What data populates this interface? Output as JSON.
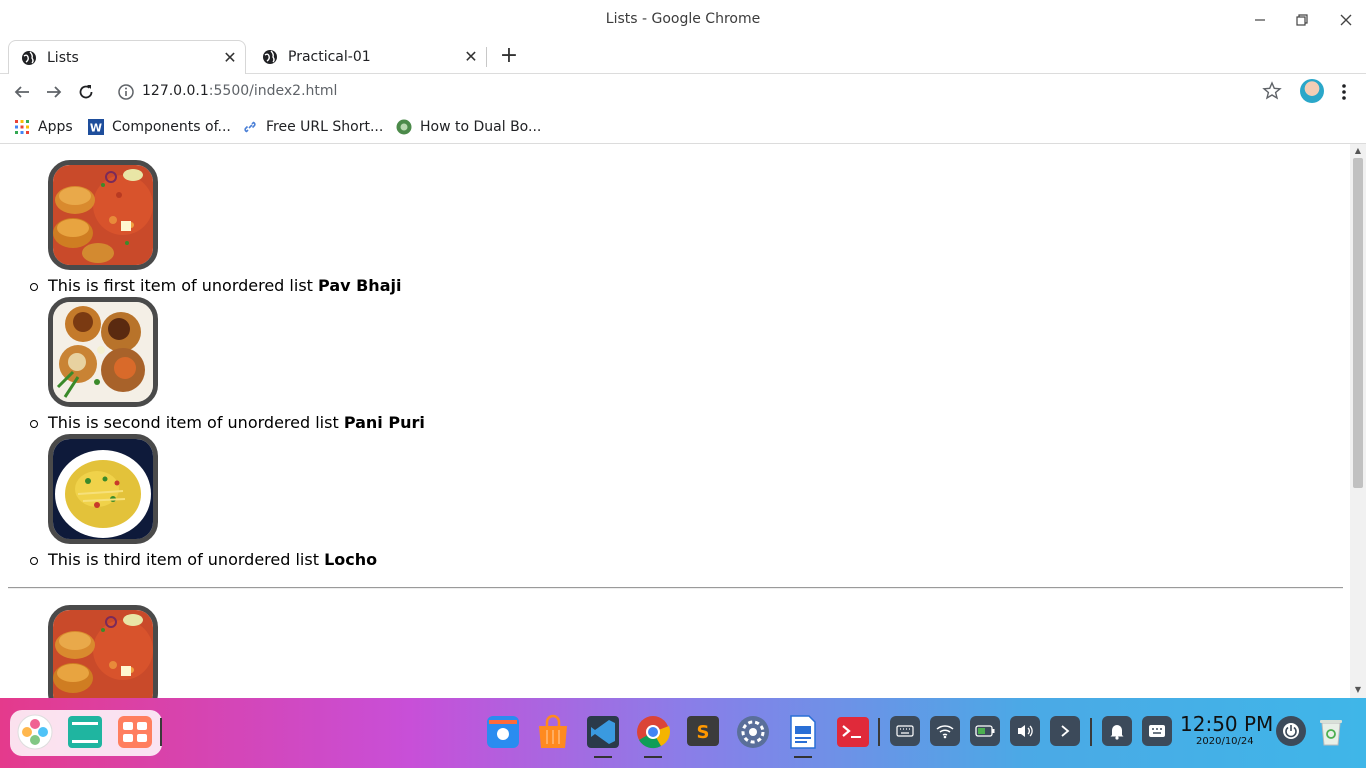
{
  "window": {
    "title": "Lists - Google Chrome"
  },
  "tabs": [
    {
      "label": "Lists",
      "active": true,
      "icon": "globe-icon"
    },
    {
      "label": "Practical-01",
      "active": false,
      "icon": "globe-icon"
    }
  ],
  "address_bar": {
    "url_host": "127.0.0.1",
    "url_rest": ":5500/index2.html"
  },
  "bookmarks": [
    {
      "label": "Apps",
      "icon": "apps-grid-icon"
    },
    {
      "label": "Components of...",
      "icon": "word-doc-icon"
    },
    {
      "label": "Free URL Short...",
      "icon": "link-icon"
    },
    {
      "label": "How to Dual Bo...",
      "icon": "site-icon"
    }
  ],
  "page": {
    "items": [
      {
        "text": "This is first item of unordered list ",
        "bold": "Pav Bhaji",
        "image": "pav-bhaji"
      },
      {
        "text": "This is second item of unordered list ",
        "bold": "Pani Puri",
        "image": "pani-puri"
      },
      {
        "text": "This is third item of unordered list ",
        "bold": "Locho",
        "image": "locho"
      }
    ],
    "second_list_first_image": "pav-bhaji"
  },
  "taskbar": {
    "time": "12:50 PM",
    "date": "2020/10/24",
    "apps": [
      "launcher-icon",
      "terminal-files-icon",
      "multitask-icon",
      "finder-icon",
      "app-store-icon",
      "vscode-icon",
      "chrome-icon",
      "sublime-text-icon",
      "settings-icon",
      "writer-icon",
      "terminal-icon"
    ],
    "tray": [
      "keyboard-icon",
      "wifi-icon",
      "battery-icon",
      "volume-icon",
      "expand-icon",
      "notification-icon",
      "input-method-icon",
      "power-icon",
      "trash-icon"
    ]
  },
  "colors": {
    "accent": "#1a73e8",
    "image_border": "#4a4a4a"
  }
}
